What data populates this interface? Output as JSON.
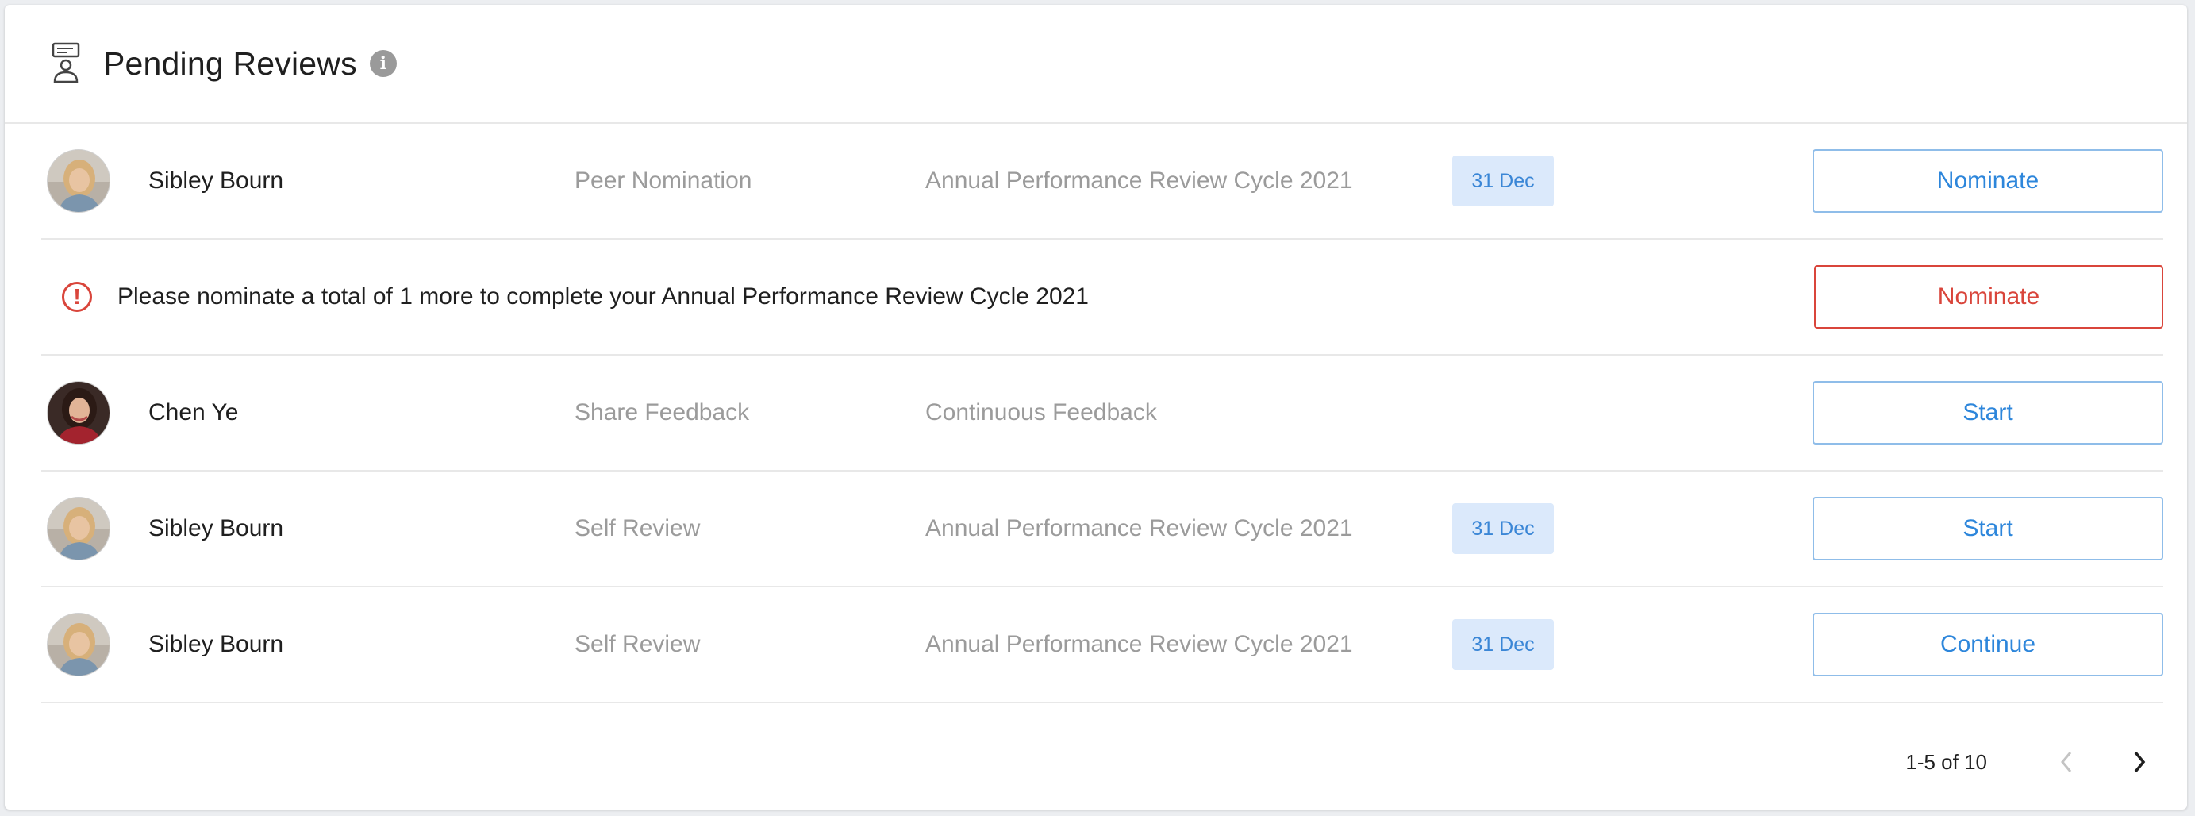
{
  "header": {
    "title": "Pending Reviews"
  },
  "rows": [
    {
      "name": "Sibley Bourn",
      "type": "Peer Nomination",
      "cycle": "Annual Performance Review Cycle 2021",
      "due": "31 Dec",
      "action": "Nominate"
    },
    {
      "alert": "Please nominate a total of 1 more to complete your Annual Performance Review Cycle 2021",
      "action": "Nominate"
    },
    {
      "name": "Chen Ye",
      "type": "Share Feedback",
      "cycle": "Continuous Feedback",
      "due": "",
      "action": "Start"
    },
    {
      "name": "Sibley Bourn",
      "type": "Self Review",
      "cycle": "Annual Performance Review Cycle 2021",
      "due": "31 Dec",
      "action": "Start"
    },
    {
      "name": "Sibley Bourn",
      "type": "Self Review",
      "cycle": "Annual Performance Review Cycle 2021",
      "due": "31 Dec",
      "action": "Continue"
    }
  ],
  "pagination": {
    "range": "1-5 of 10"
  },
  "icons": {
    "header": "review-person-icon",
    "info": "info-icon",
    "alert": "alert-circle-icon",
    "prev": "chevron-left-icon",
    "next": "chevron-right-icon"
  },
  "colors": {
    "accent": "#2d86db",
    "warning": "#d9453b",
    "badge_bg": "#dbe9fb"
  }
}
